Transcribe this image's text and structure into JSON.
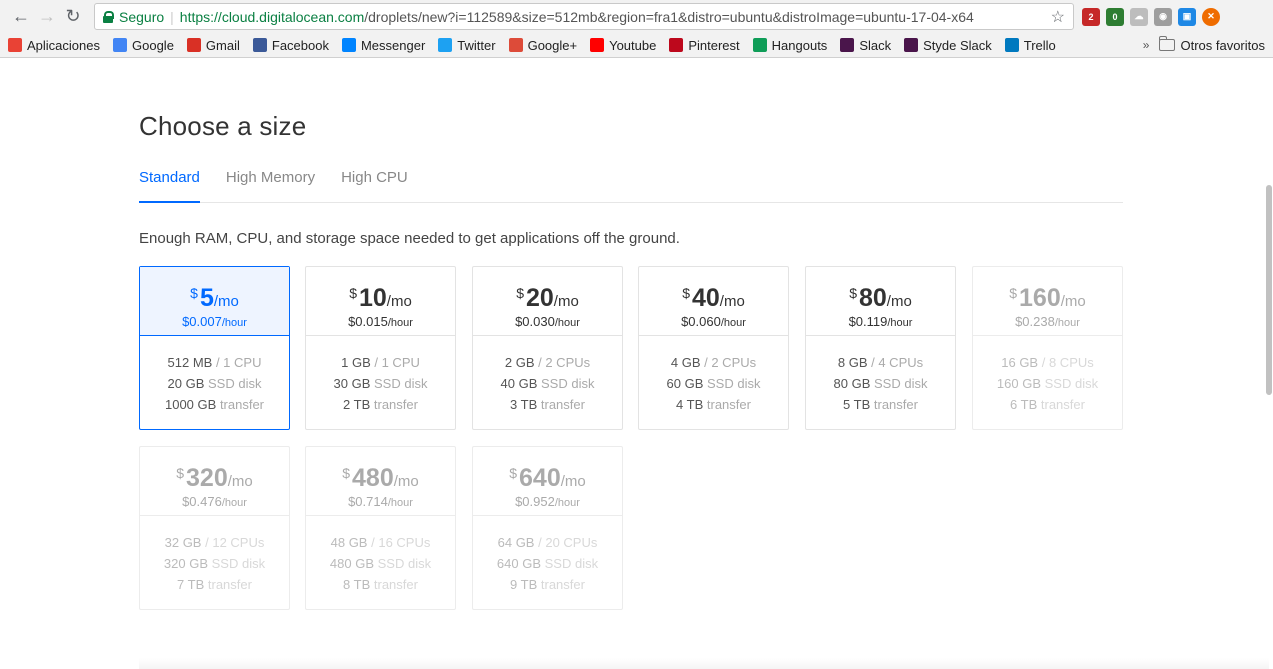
{
  "browser": {
    "secure_label": "Seguro",
    "url_host": "https://cloud.digitalocean.com",
    "url_rest": "/droplets/new?i=112589&size=512mb&region=fra1&distro=ubuntu&distroImage=ubuntu-17-04-x64",
    "bookmarks": [
      {
        "label": "Aplicaciones",
        "icon": "apps-grid-icon",
        "color": "#e94235"
      },
      {
        "label": "Google",
        "icon": "google-icon",
        "color": "#4285f4"
      },
      {
        "label": "Gmail",
        "icon": "gmail-icon",
        "color": "#d93025"
      },
      {
        "label": "Facebook",
        "icon": "facebook-icon",
        "color": "#3b5998"
      },
      {
        "label": "Messenger",
        "icon": "messenger-icon",
        "color": "#0084ff"
      },
      {
        "label": "Twitter",
        "icon": "twitter-icon",
        "color": "#1da1f2"
      },
      {
        "label": "Google+",
        "icon": "google-plus-icon",
        "color": "#dd4b39"
      },
      {
        "label": "Youtube",
        "icon": "youtube-icon",
        "color": "#ff0000"
      },
      {
        "label": "Pinterest",
        "icon": "pinterest-icon",
        "color": "#bd081c"
      },
      {
        "label": "Hangouts",
        "icon": "hangouts-icon",
        "color": "#0f9d58"
      },
      {
        "label": "Slack",
        "icon": "slack-icon",
        "color": "#4a154b"
      },
      {
        "label": "Styde Slack",
        "icon": "slack-icon",
        "color": "#4a154b"
      },
      {
        "label": "Trello",
        "icon": "trello-icon",
        "color": "#0079bf"
      }
    ],
    "other_bookmarks": "Otros favoritos",
    "more_chevron": "»"
  },
  "page": {
    "title": "Choose a size",
    "tabs": [
      {
        "label": "Standard",
        "active": true
      },
      {
        "label": "High Memory",
        "active": false
      },
      {
        "label": "High CPU",
        "active": false
      }
    ],
    "description": "Enough RAM, CPU, and storage space needed to get applications off the ground."
  },
  "sizes": [
    {
      "currency": "$",
      "amount": "5",
      "per": "/mo",
      "hourly": "$0.007",
      "hourly_unit": "/hour",
      "memory": "512 MB",
      "cpu": "/ 1 CPU",
      "disk": "20 GB",
      "disk_label": "SSD disk",
      "transfer": "1000 GB",
      "transfer_label": "transfer",
      "state": "selected"
    },
    {
      "currency": "$",
      "amount": "10",
      "per": "/mo",
      "hourly": "$0.015",
      "hourly_unit": "/hour",
      "memory": "1 GB",
      "cpu": "/ 1 CPU",
      "disk": "30 GB",
      "disk_label": "SSD disk",
      "transfer": "2 TB",
      "transfer_label": "transfer",
      "state": "available"
    },
    {
      "currency": "$",
      "amount": "20",
      "per": "/mo",
      "hourly": "$0.030",
      "hourly_unit": "/hour",
      "memory": "2 GB",
      "cpu": "/ 2 CPUs",
      "disk": "40 GB",
      "disk_label": "SSD disk",
      "transfer": "3 TB",
      "transfer_label": "transfer",
      "state": "available"
    },
    {
      "currency": "$",
      "amount": "40",
      "per": "/mo",
      "hourly": "$0.060",
      "hourly_unit": "/hour",
      "memory": "4 GB",
      "cpu": "/ 2 CPUs",
      "disk": "60 GB",
      "disk_label": "SSD disk",
      "transfer": "4 TB",
      "transfer_label": "transfer",
      "state": "available"
    },
    {
      "currency": "$",
      "amount": "80",
      "per": "/mo",
      "hourly": "$0.119",
      "hourly_unit": "/hour",
      "memory": "8 GB",
      "cpu": "/ 4 CPUs",
      "disk": "80 GB",
      "disk_label": "SSD disk",
      "transfer": "5 TB",
      "transfer_label": "transfer",
      "state": "available"
    },
    {
      "currency": "$",
      "amount": "160",
      "per": "/mo",
      "hourly": "$0.238",
      "hourly_unit": "/hour",
      "memory": "16 GB",
      "cpu": "/ 8 CPUs",
      "disk": "160 GB",
      "disk_label": "SSD disk",
      "transfer": "6 TB",
      "transfer_label": "transfer",
      "state": "disabled"
    },
    {
      "currency": "$",
      "amount": "320",
      "per": "/mo",
      "hourly": "$0.476",
      "hourly_unit": "/hour",
      "memory": "32 GB",
      "cpu": "/ 12 CPUs",
      "disk": "320 GB",
      "disk_label": "SSD disk",
      "transfer": "7 TB",
      "transfer_label": "transfer",
      "state": "disabled"
    },
    {
      "currency": "$",
      "amount": "480",
      "per": "/mo",
      "hourly": "$0.714",
      "hourly_unit": "/hour",
      "memory": "48 GB",
      "cpu": "/ 16 CPUs",
      "disk": "480 GB",
      "disk_label": "SSD disk",
      "transfer": "8 TB",
      "transfer_label": "transfer",
      "state": "disabled"
    },
    {
      "currency": "$",
      "amount": "640",
      "per": "/mo",
      "hourly": "$0.952",
      "hourly_unit": "/hour",
      "memory": "64 GB",
      "cpu": "/ 20 CPUs",
      "disk": "640 GB",
      "disk_label": "SSD disk",
      "transfer": "9 TB",
      "transfer_label": "transfer",
      "state": "disabled"
    }
  ],
  "colors": {
    "accent": "#0069ff",
    "secure": "#0b8043"
  }
}
